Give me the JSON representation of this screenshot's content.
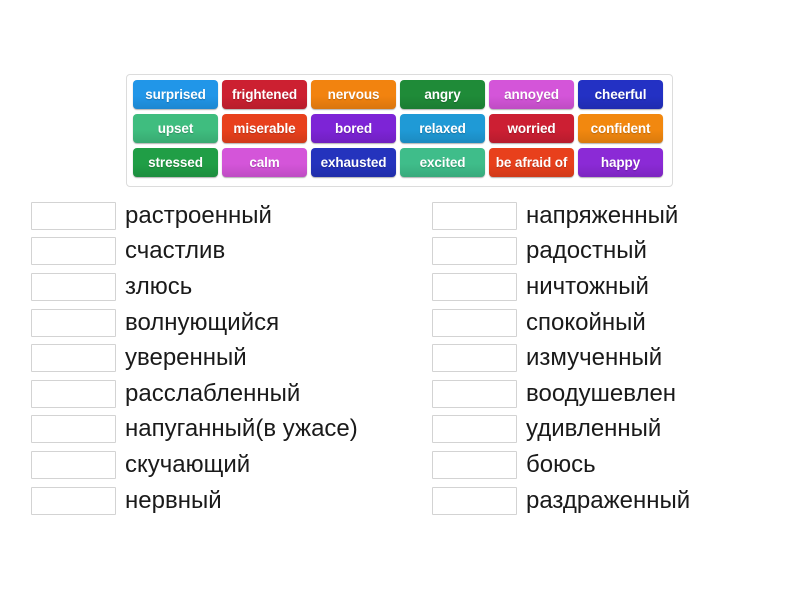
{
  "activity": {
    "type": "match-up-drag-and-drop",
    "background_color": "#ffffff"
  },
  "tile_bank": {
    "border_color": "#dcdcdc",
    "rows": [
      [
        {
          "label": "surprised",
          "color": "#2196e8",
          "text_color": "#ffffff"
        },
        {
          "label": "frightened",
          "color": "#cc2031",
          "text_color": "#ffffff"
        },
        {
          "label": "nervous",
          "color": "#f2830f",
          "text_color": "#ffffff"
        },
        {
          "label": "angry",
          "color": "#1f8b38",
          "text_color": "#ffffff"
        },
        {
          "label": "annoyed",
          "color": "#d455d9",
          "text_color": "#ffffff"
        },
        {
          "label": "cheerful",
          "color": "#2331c4",
          "text_color": "#ffffff"
        }
      ],
      [
        {
          "label": "upset",
          "color": "#3fbd7f",
          "text_color": "#ffffff"
        },
        {
          "label": "miserable",
          "color": "#e8401c",
          "text_color": "#ffffff"
        },
        {
          "label": "bored",
          "color": "#7d24d6",
          "text_color": "#ffffff"
        },
        {
          "label": "relaxed",
          "color": "#1f9ad6",
          "text_color": "#ffffff"
        },
        {
          "label": "worried",
          "color": "#cc1f33",
          "text_color": "#ffffff"
        },
        {
          "label": "confident",
          "color": "#f2880f",
          "text_color": "#ffffff"
        }
      ],
      [
        {
          "label": "stressed",
          "color": "#209e46",
          "text_color": "#ffffff"
        },
        {
          "label": "calm",
          "color": "#d455d9",
          "text_color": "#ffffff"
        },
        {
          "label": "exhausted",
          "color": "#2433bd",
          "text_color": "#ffffff"
        },
        {
          "label": "excited",
          "color": "#3fbd8a",
          "text_color": "#ffffff"
        },
        {
          "label": "be afraid of",
          "color": "#e8401c",
          "text_color": "#ffffff"
        },
        {
          "label": "happy",
          "color": "#8b2ad6",
          "text_color": "#ffffff"
        }
      ]
    ]
  },
  "answers": {
    "slot_placeholder": "",
    "left_column": [
      {
        "slot_value": "",
        "label": "растроенный"
      },
      {
        "slot_value": "",
        "label": "счастлив"
      },
      {
        "slot_value": "",
        "label": "злюсь"
      },
      {
        "slot_value": "",
        "label": "волнующийся"
      },
      {
        "slot_value": "",
        "label": "уверенный"
      },
      {
        "slot_value": "",
        "label": "расслабленный"
      },
      {
        "slot_value": "",
        "label": "напуганный(в ужасе)"
      },
      {
        "slot_value": "",
        "label": "скучающий"
      },
      {
        "slot_value": "",
        "label": "нервный"
      }
    ],
    "right_column": [
      {
        "slot_value": "",
        "label": "напряженный"
      },
      {
        "slot_value": "",
        "label": "радостный"
      },
      {
        "slot_value": "",
        "label": "ничтожный"
      },
      {
        "slot_value": "",
        "label": "спокойный"
      },
      {
        "slot_value": "",
        "label": "измученный"
      },
      {
        "slot_value": "",
        "label": "воодушевлен"
      },
      {
        "slot_value": "",
        "label": "удивленный"
      },
      {
        "slot_value": "",
        "label": "боюсь"
      },
      {
        "slot_value": "",
        "label": "раздраженный"
      }
    ]
  }
}
